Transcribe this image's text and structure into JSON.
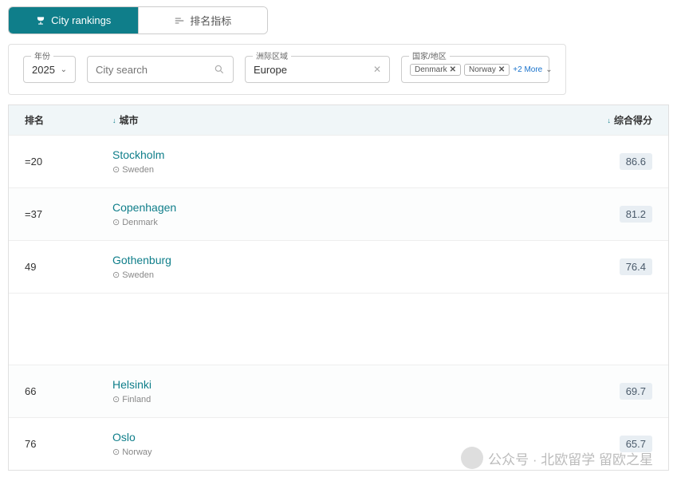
{
  "tabs": {
    "rankings": "City rankings",
    "indicators": "排名指标"
  },
  "filters": {
    "year_label": "年份",
    "year_value": "2025",
    "search_placeholder": "City search",
    "region_label": "洲际区域",
    "region_value": "Europe",
    "country_label": "国家/地区",
    "chips": [
      "Denmark",
      "Norway"
    ],
    "more": "+2 More"
  },
  "table": {
    "head": {
      "rank": "排名",
      "city": "城市",
      "score": "综合得分"
    },
    "rows": [
      {
        "rank": "=20",
        "city": "Stockholm",
        "country": "Sweden",
        "score": "86.6"
      },
      {
        "rank": "=37",
        "city": "Copenhagen",
        "country": "Denmark",
        "score": "81.2"
      },
      {
        "rank": "49",
        "city": "Gothenburg",
        "country": "Sweden",
        "score": "76.4"
      },
      {
        "rank": "66",
        "city": "Helsinki",
        "country": "Finland",
        "score": "69.7"
      },
      {
        "rank": "76",
        "city": "Oslo",
        "country": "Norway",
        "score": "65.7"
      }
    ]
  },
  "watermark": "公众号 · 北欧留学 留欧之星"
}
